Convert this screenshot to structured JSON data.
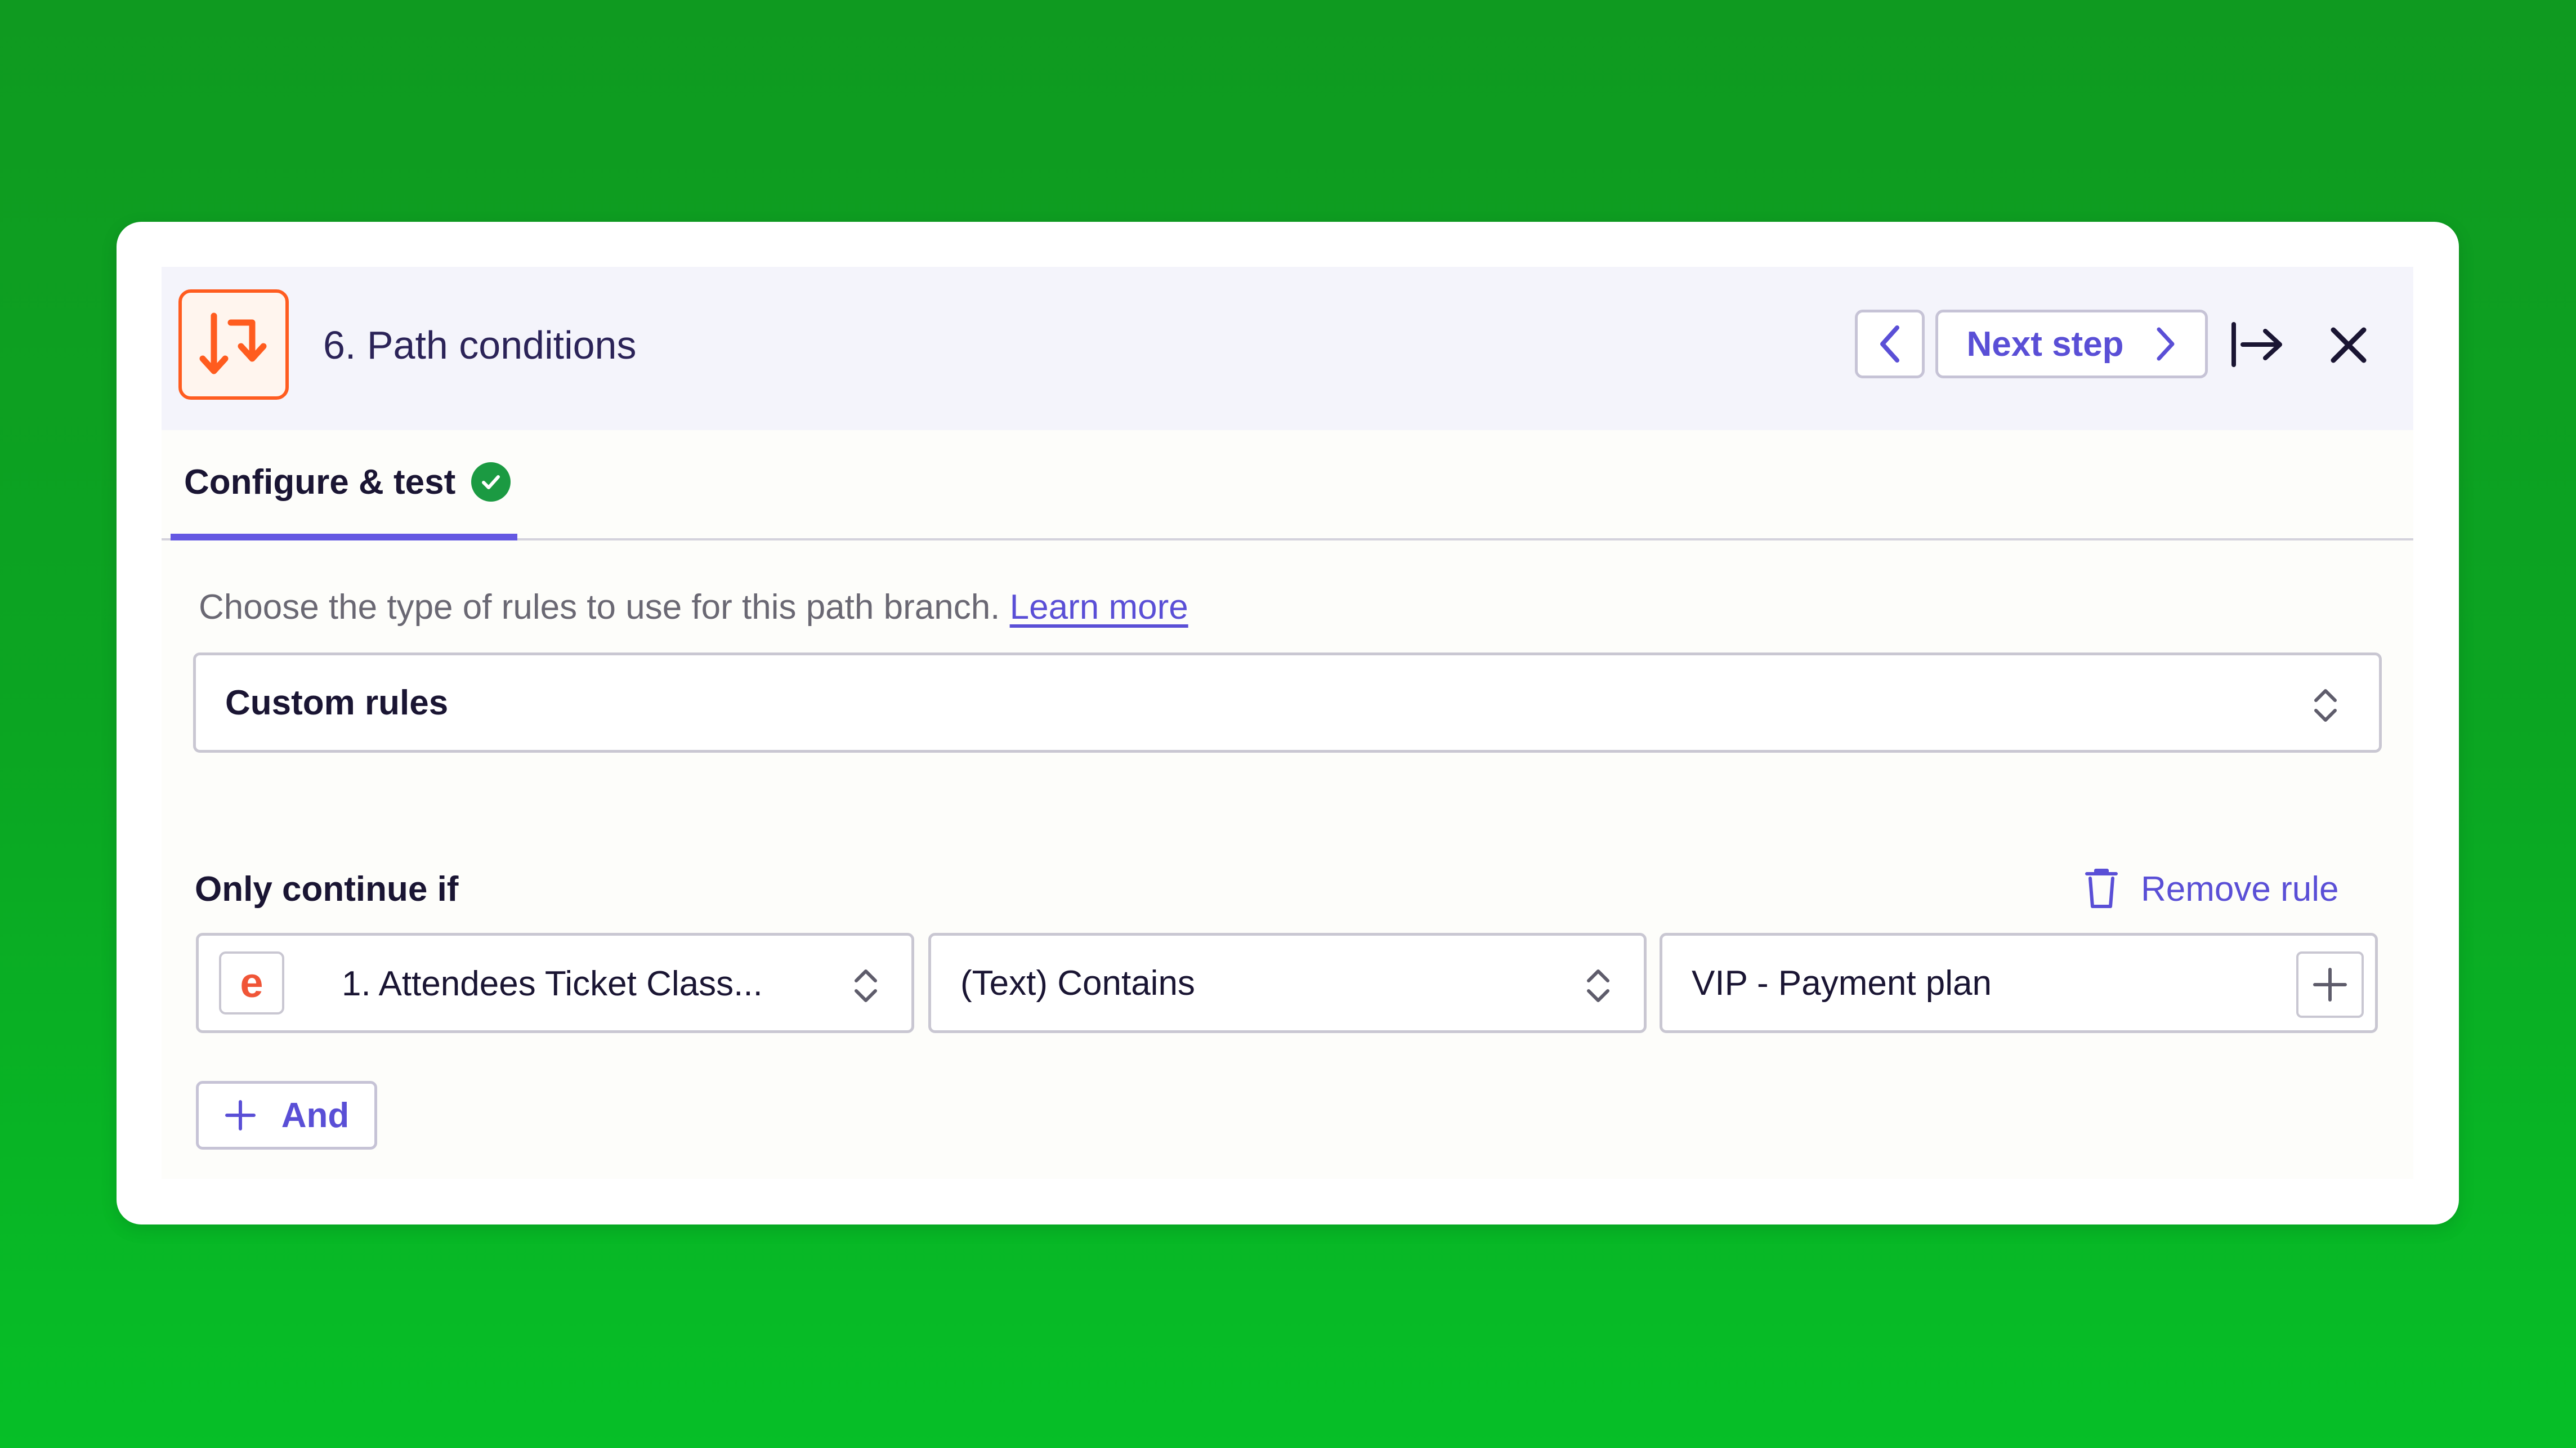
{
  "header": {
    "title": "6. Path conditions",
    "app_icon": "path-split-icon",
    "next_label": "Next step",
    "prev_icon": "chevron-left-icon",
    "next_icon": "chevron-right-icon",
    "expand_icon": "arrow-to-right-icon",
    "close_icon": "close-icon",
    "accent": "#ff5c1f",
    "link_color": "#5a4fd6"
  },
  "tabs": [
    {
      "label": "Configure & test",
      "status": "complete",
      "active": true
    }
  ],
  "rules": {
    "description": "Choose the type of rules to use for this path branch.",
    "learn_more": "Learn more",
    "selected": "Custom rules"
  },
  "condition": {
    "label": "Only continue if",
    "remove_label": "Remove rule",
    "field_app_letter": "e",
    "field": "1. Attendees Ticket Class...",
    "operator": "(Text) Contains",
    "value": "VIP - Payment plan",
    "and_label": "And"
  }
}
